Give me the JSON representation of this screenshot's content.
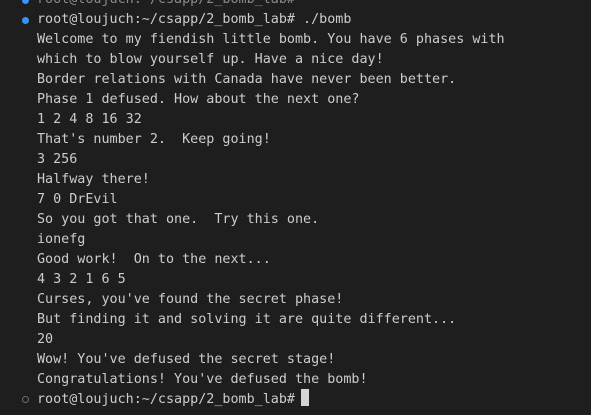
{
  "terminal": {
    "clipped_previous_line": "root@loujuch:~/csapp/2_bomb_lab#",
    "command_prompt": "root@loujuch:~/csapp/2_bomb_lab# ./bomb",
    "output_lines": [
      "Welcome to my fiendish little bomb. You have 6 phases with",
      "which to blow yourself up. Have a nice day!",
      "Border relations with Canada have never been better.",
      "Phase 1 defused. How about the next one?",
      "1 2 4 8 16 32",
      "That's number 2.  Keep going!",
      "3 256",
      "Halfway there!",
      "7 0 DrEvil",
      "So you got that one.  Try this one.",
      "ionefg",
      "Good work!  On to the next...",
      "4 3 2 1 6 5",
      "Curses, you've found the secret phase!",
      "But finding it and solving it are quite different...",
      "20",
      "Wow! You've defused the secret stage!",
      "Congratulations! You've defused the bomb!"
    ],
    "current_prompt": "root@loujuch:~/csapp/2_bomb_lab#",
    "colors": {
      "background": "#1e1e1e",
      "text": "#cccccc",
      "decoration_success": "#3794ff",
      "decoration_default": "#6b6b6b"
    }
  }
}
